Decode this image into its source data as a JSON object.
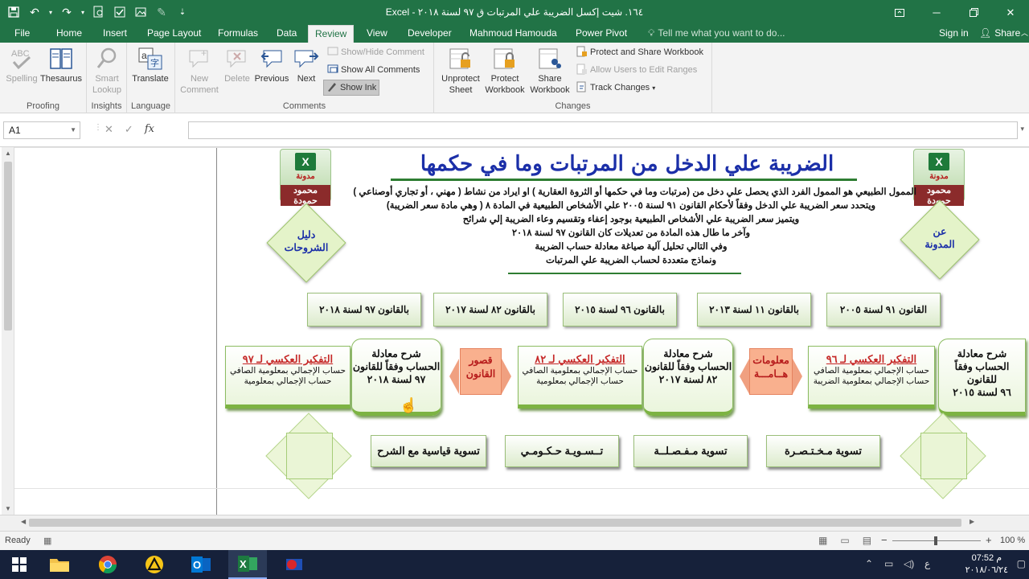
{
  "window": {
    "title": "Excel - ١٦٤. شيت إكسل الضريبة علي المرتبات ق ٩٧ لسنة ٢٠١٨",
    "controls": [
      "ribbon-display-icon",
      "minimize-icon",
      "restore-icon",
      "close-icon"
    ]
  },
  "tabs": [
    {
      "label": "File"
    },
    {
      "label": "Home"
    },
    {
      "label": "Insert"
    },
    {
      "label": "Page Layout"
    },
    {
      "label": "Formulas"
    },
    {
      "label": "Data"
    },
    {
      "label": "Review",
      "active": true
    },
    {
      "label": "View"
    },
    {
      "label": "Developer"
    },
    {
      "label": "Mahmoud Hamouda"
    },
    {
      "label": "Power Pivot"
    }
  ],
  "tell_me": "Tell me what you want to do...",
  "sign_in": "Sign in",
  "share": "Share",
  "ribbon": {
    "proofing": {
      "label": "Proofing",
      "spelling": "Spelling",
      "thesaurus": "Thesaurus"
    },
    "insights": {
      "label": "Insights",
      "smart_lookup_1": "Smart",
      "smart_lookup_2": "Lookup"
    },
    "language": {
      "label": "Language",
      "translate": "Translate"
    },
    "comments": {
      "label": "Comments",
      "new_comment_1": "New",
      "new_comment_2": "Comment",
      "delete": "Delete",
      "previous": "Previous",
      "next": "Next",
      "show_hide": "Show/Hide Comment",
      "show_all": "Show All Comments",
      "show_ink": "Show Ink"
    },
    "changes": {
      "label": "Changes",
      "unprotect_1": "Unprotect",
      "unprotect_2": "Sheet",
      "protect_wb_1": "Protect",
      "protect_wb_2": "Workbook",
      "share_wb_1": "Share",
      "share_wb_2": "Workbook",
      "protect_share": "Protect and Share Workbook",
      "allow_users": "Allow Users to Edit Ranges",
      "track_changes": "Track Changes"
    }
  },
  "formula_bar": {
    "name_box": "A1",
    "fx": "fx",
    "formula": ""
  },
  "sheet": {
    "title": "الضريبة علي الدخل من المرتبات وما في حكمها",
    "intro": [
      "الممول الطبيعي هو الممول الفرد الذي يحصل علي دخل من (مرتبات وما في حكمها أو الثروة العقارية ) او ايراد من نشاط ( مهني ، أو تجاري أوصناعي )",
      "ويتحدد سعر الضريبة علي الدخل وفقاً لأحكام القانون ٩١ لسنة ٢٠٠٥ علي الأشخاص الطبيعية في المادة ٨ ( وهي مادة سعر الضريبة)",
      "ويتميز سعر الضريبة علي الأشخاص الطبيعية بوجود إعفاء وتقسيم وعاء الضريبة إلي شرائح",
      "وآخر ما طال هذه المادة من تعديلات كان القانون ٩٧ لسنة ٢٠١٨",
      "وفي التالي تحليل آلية صياغة معادلة حساب الضريبة",
      "ونماذج متعددة لحساب الضريبة علي المرتبات"
    ],
    "logo": {
      "small": "مدونة",
      "name": "محمود حمودة",
      "mark": "X"
    },
    "left_nav": "دليل الشروحات",
    "right_nav": "عن المدونة",
    "laws": [
      "بالقانون ٩٧ لسنة ٢٠١٨",
      "بالقانون ٨٢ لسنة ٢٠١٧",
      "بالقانون ٩٦ لسنة ٢٠١٥",
      "بالقانون ١١ لسنة ٢٠١٣",
      "القانون ٩١ لسنة ٢٠٠٥"
    ],
    "reverse_cards": [
      {
        "title": "التفكير العكسي لـ ٩٧",
        "lines": [
          "حساب الإجمالي بمعلومية الصافي",
          "حساب الإجمالي بمعلومية"
        ]
      },
      {
        "title": "التفكير العكسي لـ ٨٢",
        "lines": [
          "حساب الإجمالي بمعلومية الصافي",
          "حساب الإجمالي بمعلومية"
        ]
      },
      {
        "title": "التفكير العكسي لـ ٩٦",
        "lines": [
          "حساب الإجمالي بمعلومية الصافي",
          "حساب الإجمالي بمعلومية الضريبة"
        ]
      }
    ],
    "equation_cards": [
      {
        "lines": [
          "شرح معادلة",
          "الحساب وفقاً للقانون",
          "٩٧ لسنة ٢٠١٨"
        ]
      },
      {
        "lines": [
          "شرح معادلة",
          "الحساب وفقاً للقانون",
          "٨٢ لسنة ٢٠١٧"
        ]
      },
      {
        "lines": [
          "شرح معادلة",
          "الحساب وفقاً للقانون",
          "٩٦ لسنة ٢٠١٥"
        ]
      }
    ],
    "law_gaps": [
      "قصور",
      "القانون"
    ],
    "important_info": [
      "معلومات",
      "هــامـــة"
    ],
    "settlements": [
      "تسوية قياسية مع الشرح",
      "تــسـويـة حـكـومـي",
      "تسوية مـفـصـلــة",
      "تسوية مـخـتـصـرة"
    ]
  },
  "status": {
    "ready": "Ready",
    "zoom": "100 %",
    "zoom_minus": "−",
    "zoom_plus": "+",
    "zoom_level": 0.5
  },
  "taskbar": {
    "clock_time": "07:52 م",
    "clock_date": "٢٠١٨/٠٦/٢٤",
    "lang": "ع",
    "apps": [
      "windows-start",
      "file-explorer",
      "chrome",
      "autocad",
      "outlook",
      "excel",
      "screen-recorder"
    ]
  },
  "colors": {
    "excel_green": "#217346",
    "title_blue": "#1b2fa8",
    "accent_red": "#c62828",
    "card_green": "#7cb342",
    "orange": "#f9b08e"
  }
}
